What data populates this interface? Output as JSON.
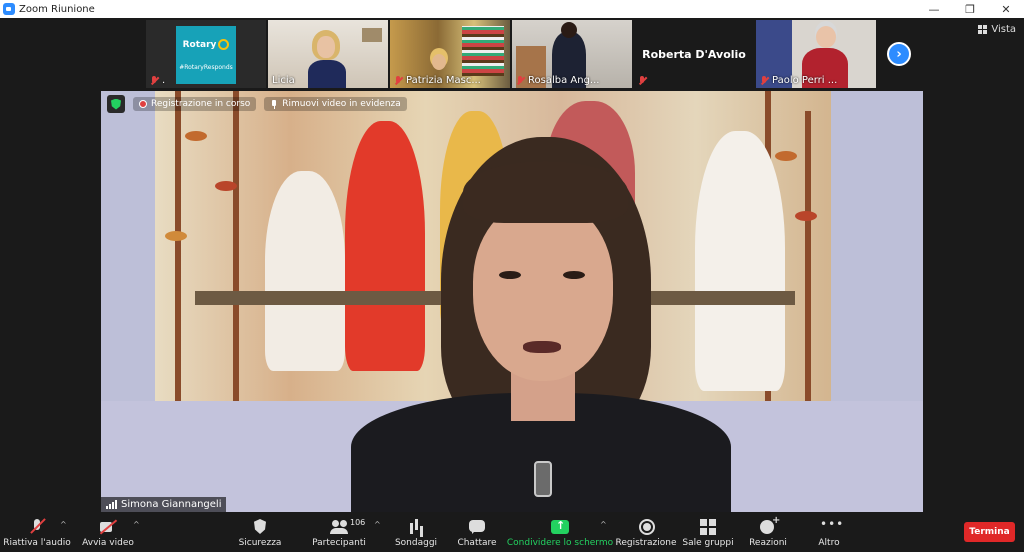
{
  "window": {
    "title": "Zoom Riunione",
    "minimize": "—",
    "restore": "❐",
    "close": "✕"
  },
  "view_button": {
    "label": "Vista"
  },
  "filmstrip": {
    "tiles": [
      {
        "name": ".",
        "logo_title": "Rotary",
        "logo_tag": "#RotaryResponds",
        "muted": true
      },
      {
        "name": "Licia",
        "muted": false
      },
      {
        "name": "Patrizia Masc...",
        "muted": true
      },
      {
        "name": "Rosalba Ang...",
        "muted": true
      },
      {
        "name": "",
        "display_name": "Roberta D'Avolio",
        "muted": true
      },
      {
        "name": "Paolo  Perri ...",
        "muted": true
      }
    ],
    "next_label": "›"
  },
  "speaker": {
    "name": "Simona Giannangeli",
    "recording_label": "Registrazione in corso",
    "unpin_label": "Rimuovi video in evidenza"
  },
  "toolbar": {
    "unmute_label": "Riattiva l'audio",
    "start_video_label": "Avvia video",
    "security_label": "Sicurezza",
    "participants_label": "Partecipanti",
    "participants_count": "106",
    "polls_label": "Sondaggi",
    "chat_label": "Chattare",
    "share_label": "Condividere lo schermo",
    "record_label": "Registrazione",
    "breakout_label": "Sale gruppi",
    "reactions_label": "Reazioni",
    "more_label": "Altro",
    "end_label": "Termina",
    "caret": "^"
  },
  "colors": {
    "accent": "#2d8cff",
    "share_green": "#23d160",
    "end_red": "#e02828",
    "mute_red": "#e04040"
  }
}
